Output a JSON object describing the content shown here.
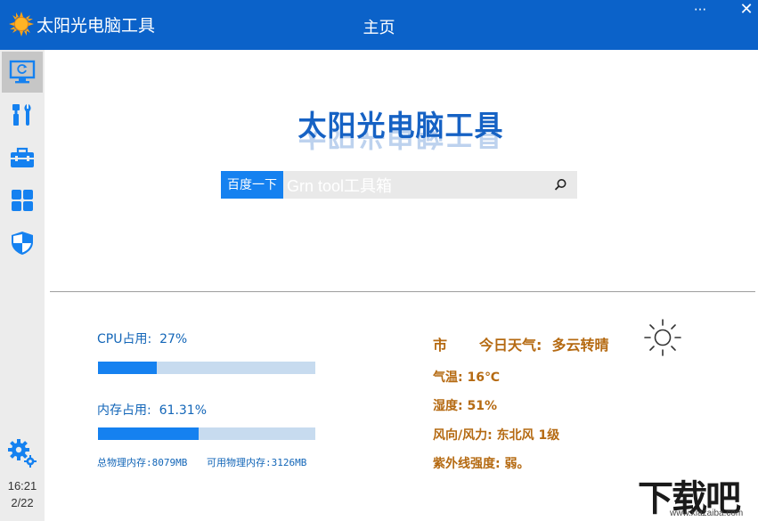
{
  "titlebar": {
    "app_title": "太阳光电脑工具",
    "page_title": "主页",
    "more_label": "···",
    "close_label": "✕"
  },
  "sidebar": {
    "items": [
      {
        "icon": "monitor-refresh-icon",
        "active": true
      },
      {
        "icon": "tools-icon",
        "active": false
      },
      {
        "icon": "toolbox-icon",
        "active": false
      },
      {
        "icon": "apps-grid-icon",
        "active": false
      },
      {
        "icon": "shield-icon",
        "active": false
      }
    ],
    "settings_icon": "gears-icon",
    "time": "16:21",
    "date": "2/22"
  },
  "main": {
    "brand": "太阳光电脑工具",
    "search": {
      "button_label": "百度一下",
      "value": "Grn tool工具箱"
    }
  },
  "stats": {
    "cpu_label": "CPU占用:",
    "cpu_value": "27%",
    "cpu_fraction": 0.27,
    "mem_label": "内存占用:",
    "mem_value": "61.31%",
    "mem_fraction": 0.4627,
    "total_mem": "总物理内存:8079MB",
    "avail_mem": "可用物理内存:3126MB"
  },
  "weather": {
    "city": "市",
    "today_label": "今日天气:",
    "today_value": "多云转晴",
    "temp": "气温: 16℃",
    "humidity": "湿度: 51%",
    "wind": "风向/风力: 东北风 1级",
    "uv": "紫外线强度: 弱。",
    "icon": "sun-icon"
  },
  "watermark": {
    "main": "下载吧",
    "sub": "www.xiazaiba.com"
  },
  "colors": {
    "titlebar": "#0b62c9",
    "accent": "#1581f0",
    "stat_text": "#1366b8",
    "weather_text": "#b56a12",
    "bar_track": "#c7dbef"
  }
}
